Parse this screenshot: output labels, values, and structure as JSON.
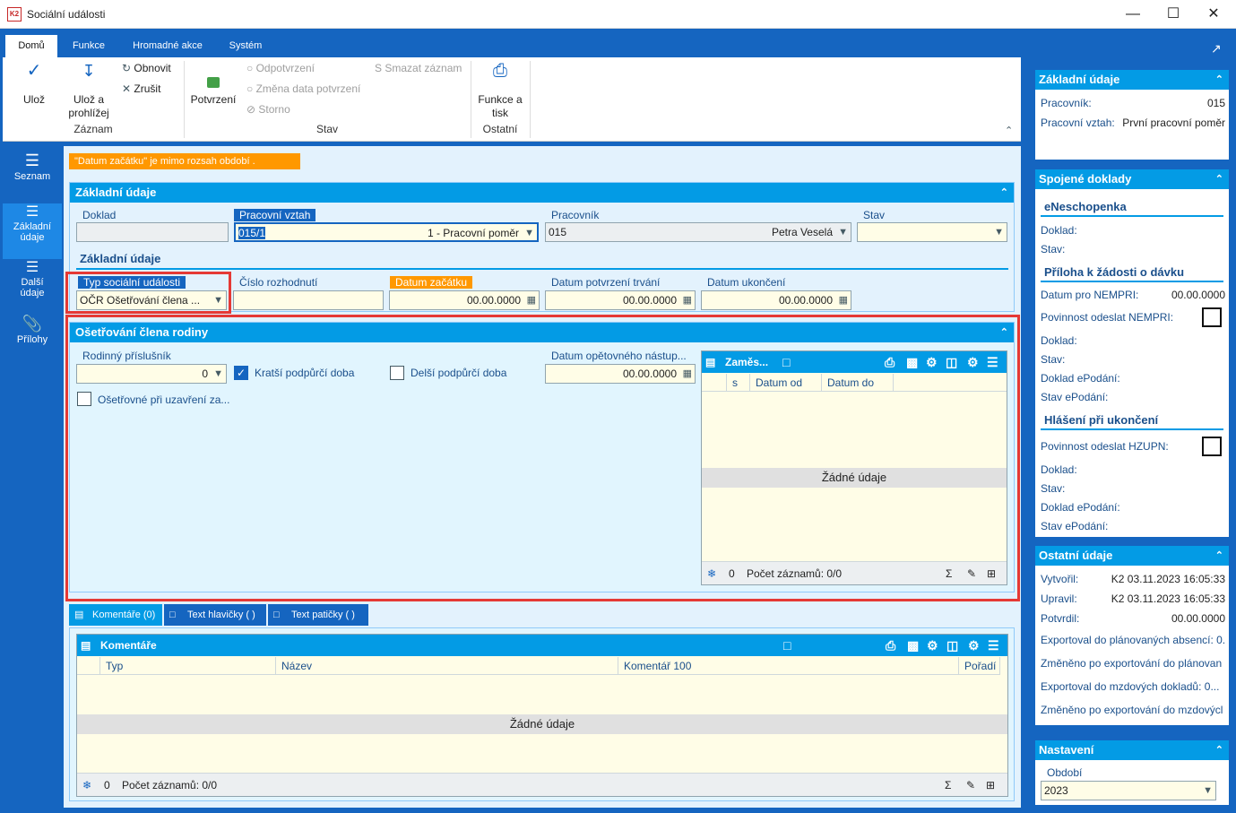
{
  "window": {
    "title": "Sociální události"
  },
  "ribbon": {
    "tabs": [
      "Domů",
      "Funkce",
      "Hromadné akce",
      "Systém"
    ],
    "uloz": "Ulož",
    "uloz_prohlizej": "Ulož a prohlížej",
    "obnovit": "Obnovit",
    "zrusit": "Zrušit",
    "zaznam": "Záznam",
    "potvrzeni": "Potvrzení",
    "odpotvrzeni": "Odpotvrzení",
    "zmena_data": "Změna data potvrzení",
    "storno": "Storno",
    "smazat": "Smazat záznam",
    "stav": "Stav",
    "funkce_tisk": "Funkce a tisk",
    "ostatni": "Ostatní"
  },
  "sidebar": {
    "items": [
      "Seznam",
      "Základní údaje",
      "Další údaje",
      "Přílohy"
    ]
  },
  "banner": "\"Datum začátku\" je mimo rozsah období .",
  "zakladni": {
    "title": "Základní údaje",
    "doklad_label": "Doklad",
    "doklad_value": "",
    "pv_label": "Pracovní vztah",
    "pv_value": "015/1",
    "pv_text": "1 - Pracovní poměr",
    "pracovnik_label": "Pracovník",
    "pracovnik_value": "015",
    "pracovnik_name": "Petra Veselá",
    "stav_label": "Stav",
    "stav_value": "",
    "sub": "Základní údaje",
    "typ_label": "Typ sociální události",
    "typ_value": "OČR Ošetřování člena ...",
    "cislo_label": "Číslo rozhodnutí",
    "cislo_value": "",
    "zacatek_label": "Datum začátku",
    "zacatek_value": "00.00.0000",
    "potvrzeni_label": "Datum potvrzení trvání",
    "potvrzeni_value": "00.00.0000",
    "ukonceni_label": "Datum ukončení",
    "ukonceni_value": "00.00.0000"
  },
  "osetrovani": {
    "title": "Ošetřování člena rodiny",
    "rodinny_label": "Rodinný příslušník",
    "rodinny_value": "0",
    "kratsi": "Kratší podpůrčí doba",
    "delsi": "Delší podpůrčí doba",
    "nastup_label": "Datum opětovného nástup...",
    "nastup_value": "00.00.0000",
    "uzavreni": "Ošetřovné při uzavření za...",
    "grid": {
      "title": "Zaměs...",
      "cols": [
        "s",
        "Datum od",
        "Datum do"
      ],
      "empty": "Žádné údaje",
      "count": "0",
      "records": "Počet záznamů: 0/0"
    }
  },
  "bottom_tabs": [
    "Komentáře (0)",
    "Text hlavičky ( )",
    "Text patičky ( )"
  ],
  "komentare": {
    "title": "Komentáře",
    "cols": [
      "Typ",
      "Název",
      "Komentář 100",
      "Pořadí"
    ],
    "empty": "Žádné údaje",
    "count": "0",
    "records": "Počet záznamů: 0/0"
  },
  "right": {
    "zakladni": {
      "title": "Základní údaje",
      "rows": [
        [
          "Pracovník:",
          "015"
        ],
        [
          "Pracovní vztah:",
          "První pracovní poměr"
        ]
      ]
    },
    "spojene": {
      "title": "Spojené doklady",
      "eneschopenka": "eNeschopenka",
      "e_rows": [
        "Doklad:",
        "Stav:"
      ],
      "priloha": "Příloha k žádosti o dávku",
      "p_rows": [
        [
          "Datum pro NEMPRI:",
          "00.00.0000"
        ],
        [
          "Povinnost odeslat NEMPRI:",
          ""
        ],
        [
          "Doklad:",
          ""
        ],
        [
          "Stav:",
          ""
        ],
        [
          "Doklad ePodání:",
          ""
        ],
        [
          "Stav ePodání:",
          ""
        ]
      ],
      "hlaseni": "Hlášení při ukončení",
      "h_rows": [
        "Povinnost odeslat HZUPN:",
        "Doklad:",
        "Stav:",
        "Doklad ePodání:",
        "Stav ePodání:"
      ]
    },
    "ostatni": {
      "title": "Ostatní údaje",
      "rows": [
        [
          "Vytvořil:",
          "K2 03.11.2023 16:05:33"
        ],
        [
          "Upravil:",
          "K2 03.11.2023 16:05:33"
        ],
        [
          "Potvrdil:",
          "00.00.0000"
        ],
        [
          "Exportoval do plánovaných absencí: 0.",
          ""
        ],
        [
          "Změněno po exportování do plánovan",
          ""
        ],
        [
          "Exportoval do mzdových dokladů: 0...",
          ""
        ],
        [
          "Změněno po exportování do mzdovýcl",
          ""
        ]
      ]
    },
    "nastaveni": {
      "title": "Nastavení",
      "obdobi_label": "Období",
      "obdobi_value": "2023"
    }
  }
}
